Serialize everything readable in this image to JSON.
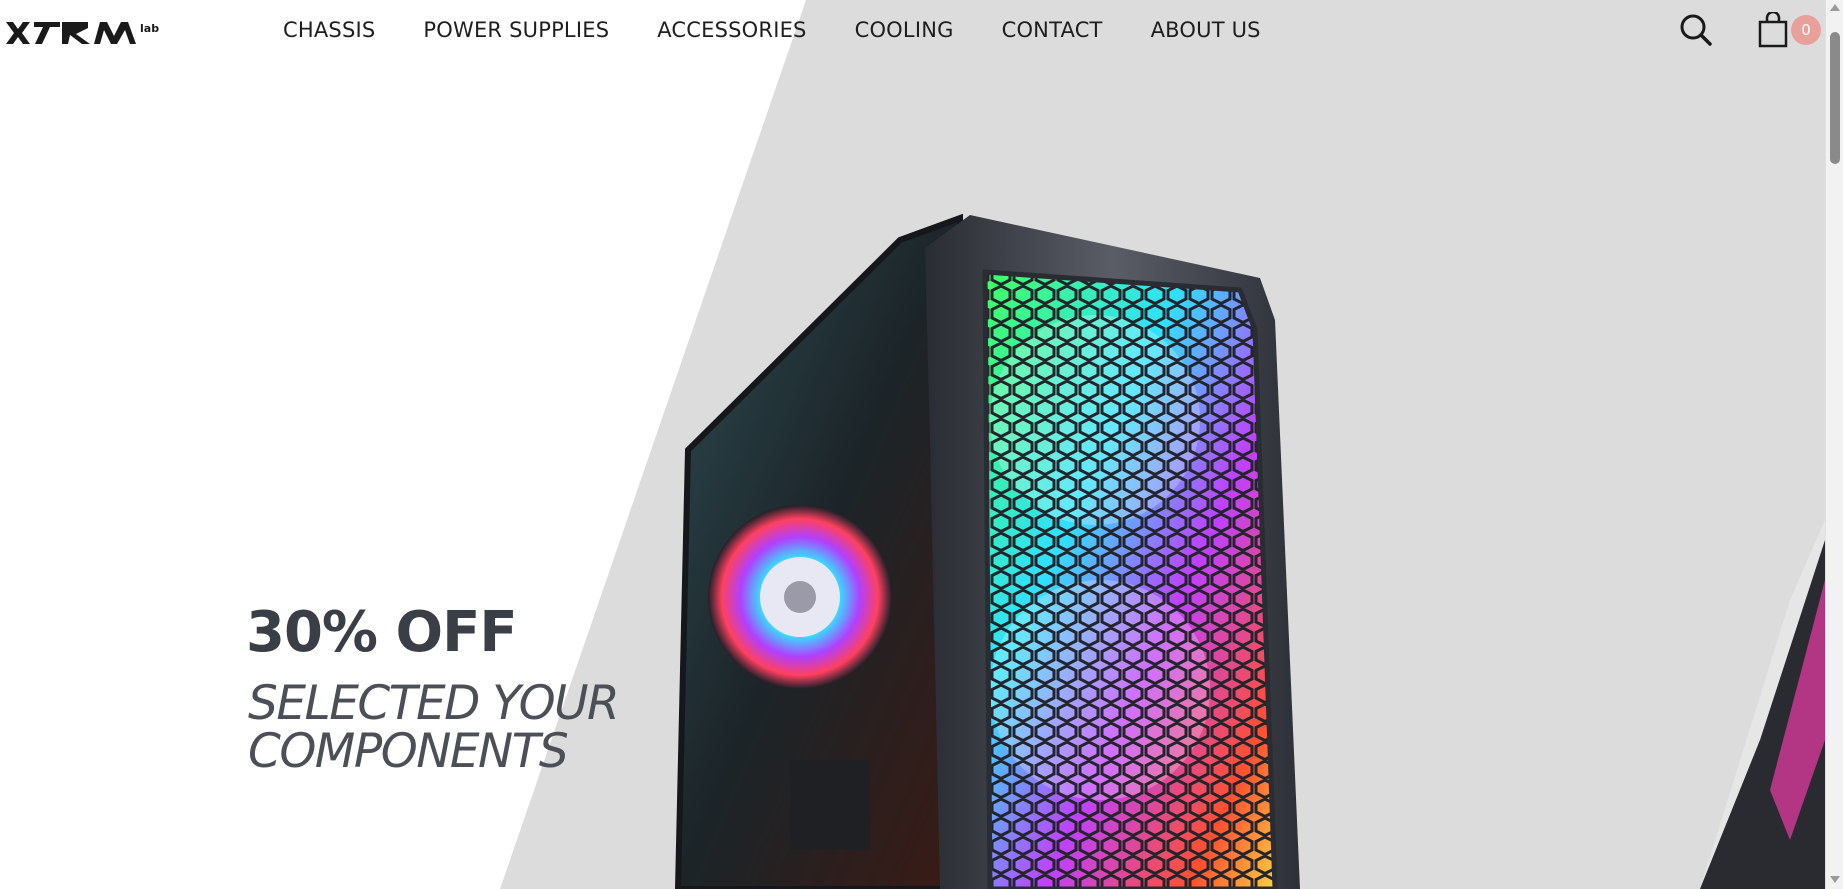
{
  "header": {
    "logo_text": "XTRM lab",
    "nav": [
      {
        "label": "CHASSIS"
      },
      {
        "label": "POWER SUPPLIES"
      },
      {
        "label": "ACCESSORIES"
      },
      {
        "label": "COOLING"
      },
      {
        "label": "CONTACT"
      },
      {
        "label": "ABOUT US"
      }
    ],
    "search_icon": "search-icon",
    "cart_icon": "shopping-bag-icon",
    "cart_count": "0"
  },
  "hero": {
    "title": "30% OFF",
    "subtitle": "SELECTED YOUR COMPONENTS",
    "product": "pc-case-rgb-fans"
  },
  "colors": {
    "hero_panel": "#dcdcdc",
    "badge": "#e8a19a",
    "text_dark": "#3a3f47"
  }
}
